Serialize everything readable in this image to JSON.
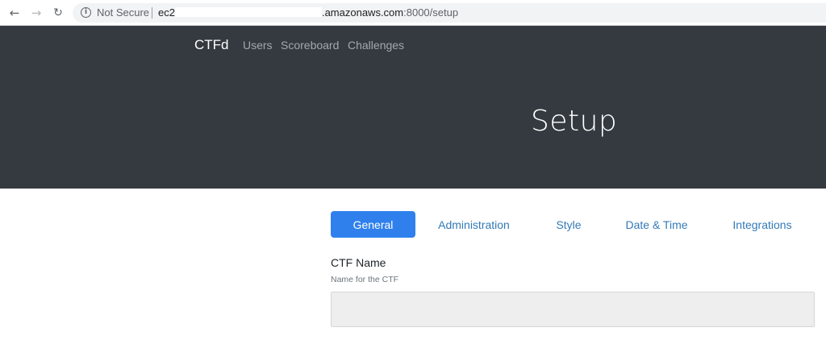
{
  "browser": {
    "back_icon": "←",
    "forward_icon": "→",
    "reload_icon": "↻",
    "info_icon": "i",
    "security_label": "Not Secure",
    "url_prefix": "ec2",
    "url_host": ".amazonaws.com",
    "url_path": ":8000/setup"
  },
  "navbar": {
    "brand": "CTFd",
    "links": [
      "Users",
      "Scoreboard",
      "Challenges"
    ]
  },
  "header": {
    "title": "Setup"
  },
  "tabs": [
    {
      "label": "General",
      "active": true
    },
    {
      "label": "Administration",
      "active": false
    },
    {
      "label": "Style",
      "active": false
    },
    {
      "label": "Date & Time",
      "active": false
    },
    {
      "label": "Integrations",
      "active": false
    }
  ],
  "form": {
    "ctf_name_label": "CTF Name",
    "ctf_name_help": "Name for the CTF",
    "ctf_name_value": ""
  },
  "colors": {
    "header_bg": "#343a40",
    "tab_active_bg": "#2f80ed",
    "tab_link": "#337ab7",
    "input_bg": "#eeeeee"
  }
}
